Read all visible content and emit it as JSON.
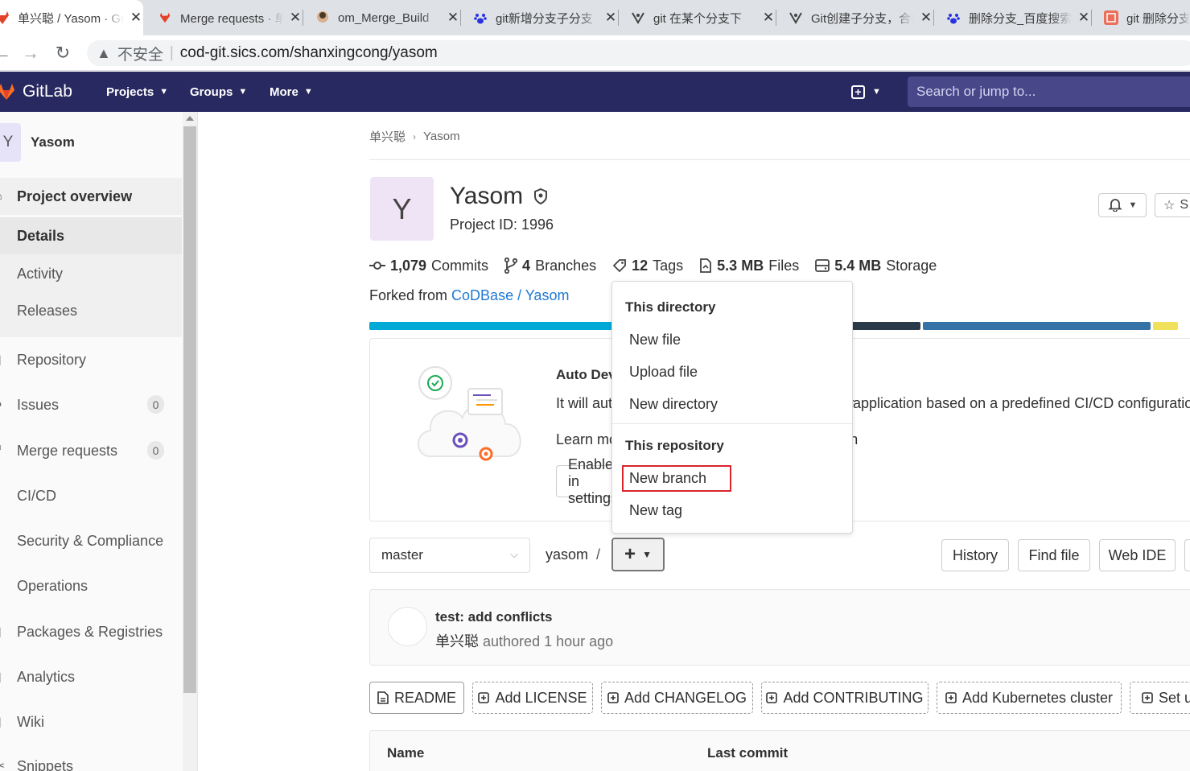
{
  "browser": {
    "tabs": [
      {
        "title": "单兴聪 / Yasom · GitLab",
        "active": true,
        "icon": "gitlab-favicon"
      },
      {
        "title": "Merge requests · 单兴聪 / Yasom",
        "active": false,
        "icon": "gitlab-favicon"
      },
      {
        "title": "om_Merge_Build",
        "active": false,
        "icon": "jenkins-favicon"
      },
      {
        "title": "git新增分支子分支",
        "active": false,
        "icon": "baidu-favicon"
      },
      {
        "title": "git 在某个分支下",
        "active": false,
        "icon": "csdn-favicon"
      },
      {
        "title": "Git创建子分支，合并",
        "active": false,
        "icon": "csdn-favicon"
      },
      {
        "title": "删除分支_百度搜索",
        "active": false,
        "icon": "baidu-favicon"
      },
      {
        "title": "git 删除分支",
        "active": false,
        "icon": "jianshu-favicon"
      }
    ],
    "close_glyph": "✕",
    "security_label": "不安全",
    "url": "cod-git.sics.com/shanxingcong/yasom"
  },
  "header": {
    "brand": "GitLab",
    "nav": [
      "Projects",
      "Groups",
      "More"
    ],
    "search_placeholder": "Search or jump to..."
  },
  "sidebar": {
    "avatar_letter": "Y",
    "project_name": "Yasom",
    "overview_label": "Project overview",
    "sub_items": [
      {
        "label": "Details",
        "active": true
      },
      {
        "label": "Activity",
        "active": false
      },
      {
        "label": "Releases",
        "active": false
      }
    ],
    "items": [
      {
        "label": "Repository",
        "icon": "book-icon"
      },
      {
        "label": "Issues",
        "icon": "issues-icon",
        "badge": "0"
      },
      {
        "label": "Merge requests",
        "icon": "merge-request-icon",
        "badge": "0"
      },
      {
        "label": "CI/CD",
        "icon": "rocket-icon"
      },
      {
        "label": "Security & Compliance",
        "icon": "shield-icon"
      },
      {
        "label": "Operations",
        "icon": "cloud-gear-icon"
      },
      {
        "label": "Packages & Registries",
        "icon": "package-icon"
      },
      {
        "label": "Analytics",
        "icon": "chart-icon"
      },
      {
        "label": "Wiki",
        "icon": "book-icon"
      },
      {
        "label": "Snippets",
        "icon": "snippet-icon"
      }
    ]
  },
  "breadcrumb": {
    "owner": "单兴聪",
    "project": "Yasom",
    "separator": "›"
  },
  "project": {
    "avatar_letter": "Y",
    "name": "Yasom",
    "id_text": "Project ID: 1996",
    "star_label": "S",
    "stats": [
      {
        "value": "1,079",
        "label": "Commits",
        "icon": "commit-icon"
      },
      {
        "value": "4",
        "label": "Branches",
        "icon": "branch-icon"
      },
      {
        "value": "12",
        "label": "Tags",
        "icon": "tag-icon"
      },
      {
        "value": "5.3 MB",
        "label": "Files",
        "icon": "file-icon"
      },
      {
        "value": "5.4 MB",
        "label": "Storage",
        "icon": "storage-icon"
      }
    ],
    "forked_prefix": "Forked from",
    "forked_link": "CoDBase / Yasom",
    "languages": [
      {
        "color": "#00a9d6",
        "share": 0.505
      },
      {
        "color": "#2b3a4a",
        "share": 0.157
      },
      {
        "color": "#3572a5",
        "share": 0.275
      },
      {
        "color": "#f1e05a",
        "share": 0.03
      }
    ]
  },
  "autodevops": {
    "title": "Auto DevOps",
    "text_left": "It will automatically build, test, and deploy your",
    "text_right": "application based on a predefined CI/CD configuration",
    "learn": "Learn more in the Auto DevOps documentation",
    "enable_label": "Enable in settings"
  },
  "dropdown": {
    "section1": "This directory",
    "items1": [
      "New file",
      "Upload file",
      "New directory"
    ],
    "section2": "This repository",
    "items2": [
      "New branch",
      "New tag"
    ]
  },
  "repo": {
    "branch": "master",
    "path": "yasom",
    "path_sep": "/",
    "buttons": [
      "History",
      "Find file",
      "Web IDE"
    ]
  },
  "commit": {
    "title": "test: add conflicts",
    "author": "单兴聪",
    "meta": "authored 1 hour ago"
  },
  "quick_actions": [
    {
      "label": "README",
      "dashed": false
    },
    {
      "label": "Add LICENSE",
      "dashed": true
    },
    {
      "label": "Add CHANGELOG",
      "dashed": true
    },
    {
      "label": "Add CONTRIBUTING",
      "dashed": true
    },
    {
      "label": "Add Kubernetes cluster",
      "dashed": true
    },
    {
      "label": "Set up CI/CD",
      "dashed": true
    }
  ],
  "file_table": {
    "columns": [
      "Name",
      "Last commit"
    ]
  }
}
